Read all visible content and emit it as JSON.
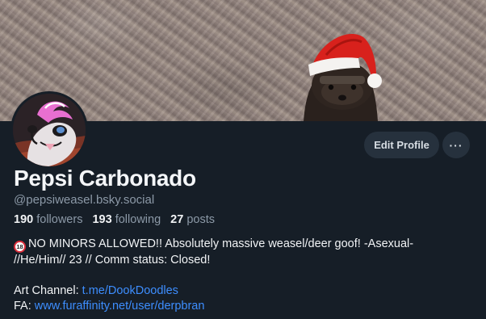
{
  "profile": {
    "display_name": "Pepsi Carbonado",
    "handle": "@pepsiweasel.bsky.social",
    "edit_button_label": "Edit Profile",
    "more_button_label": "···"
  },
  "stats": {
    "followers_count": "190",
    "followers_label": "followers",
    "following_count": "193",
    "following_label": "following",
    "posts_count": "27",
    "posts_label": "posts"
  },
  "bio": {
    "badge_text": "18",
    "line1": "NO MINORS ALLOWED!! Absolutely massive weasel/deer goof! -Asexual-",
    "line2": "//He/Him// 23 // Comm status: Closed!",
    "art_channel_label": "Art Channel: ",
    "art_channel_link": "t.me/DookDoodles",
    "fa_label": "FA: ",
    "fa_link": "www.furaffinity.net/user/derpbran"
  },
  "icons": {
    "banner": "banner-image-weasel-santa-hat",
    "avatar": "avatar-image",
    "more": "more-options-icon",
    "age_restriction": "no-under-18-icon"
  },
  "colors": {
    "background": "#161e27",
    "button_bg": "#26313d",
    "link": "#3d8eff",
    "muted_text": "#8c99a7"
  }
}
